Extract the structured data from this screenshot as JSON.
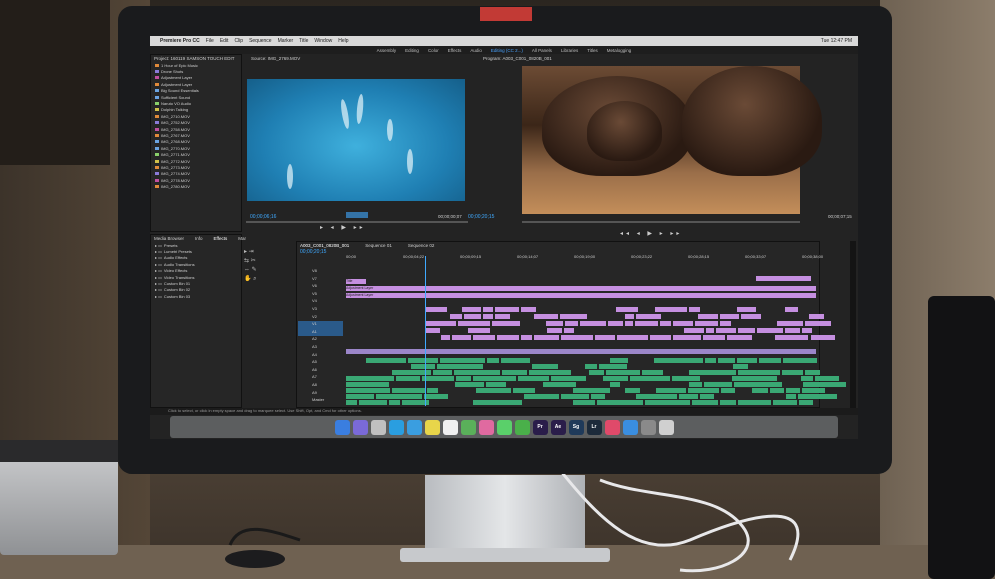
{
  "menubar": {
    "app": "Premiere Pro CC",
    "items": [
      "File",
      "Edit",
      "Clip",
      "Sequence",
      "Marker",
      "Title",
      "Window",
      "Help"
    ],
    "clock": "Tue 12:47 PM"
  },
  "workspaces": [
    "Assembly",
    "Editing",
    "Color",
    "Effects",
    "Audio",
    "Editing (CC 2...)",
    "All Panels",
    "Libraries",
    "Titles",
    "Metalogging"
  ],
  "project_panel": {
    "title": "Project: 160119 SAMSON TOUCH EDIT",
    "items": [
      "1 Hour of Epic Music",
      "Drone Shots",
      "Adjustment Layer",
      "Adjustment Layer",
      "Big Sound Essentials",
      "Sufficient Sound",
      "Naruto VO Audio",
      "Dolphin Talking",
      "IMG_2710.MOV",
      "IMG_2752.MOV",
      "IMG_2758.MOV",
      "IMG_2767.MOV",
      "IMG_2768.MOV",
      "IMG_2770.MOV",
      "IMG_2771.MOV",
      "IMG_2772.MOV",
      "IMG_2773.MOV",
      "IMG_2774.MOV",
      "IMG_2778.MOV",
      "IMG_2780.MOV"
    ]
  },
  "source_monitor": {
    "title": "Source: IMG_2769.MOV",
    "timecode_left": "00;00;06;16",
    "timecode_right": "00;00;00;07"
  },
  "program_monitor": {
    "title": "Program: A003_C001_0820B_001",
    "timecode_left": "00;00;20;15",
    "timecode_right": "00;00;07;15"
  },
  "effects_panel": {
    "tabs": [
      "Media Browser",
      "Info",
      "Effects",
      "Mar"
    ],
    "items": [
      "Presets",
      "Lumetri Presets",
      "Audio Effects",
      "Audio Transitions",
      "Video Effects",
      "Video Transitions",
      "Custom Bin 01",
      "Custom Bin 02",
      "Custom Bin 03"
    ]
  },
  "timeline": {
    "tabs": [
      "A003_C001_0820B_001",
      "Sequence 01",
      "Sequence 02"
    ],
    "timecode": "00;00;20;15",
    "ruler": [
      "00;00",
      "00;00;04;22",
      "00;00;09;15",
      "00;00;14;07",
      "00;00;19;00",
      "00;00;23;22",
      "00;00;28;15",
      "00;00;33;07",
      "00;00;38;00"
    ],
    "clip_labels": [
      "Adjustment Layer",
      "Adjustment Layer",
      "Adjustment Layer",
      "Title"
    ],
    "tracks": [
      "V8",
      "V7",
      "V6",
      "V5",
      "V4",
      "V3",
      "V2",
      "V1",
      "A1",
      "A2",
      "A3",
      "A4",
      "A5",
      "A6",
      "A7",
      "A8",
      "A9",
      "Master"
    ]
  },
  "status": "Click to select, or click in empty space and drag to marquee select. Use Shift, Opt, and Cmd for other options.",
  "dock": [
    "Finder",
    "Siri",
    "Launchpad",
    "Safari",
    "Mail",
    "Notes",
    "Calendar",
    "Maps",
    "Photos",
    "Messages",
    "FaceTime",
    "Pr",
    "Ae",
    "Sg",
    "Lr",
    "iTunes",
    "App Store",
    "Preferences",
    "Trash"
  ],
  "colors": {
    "accent": "#3fa9ff",
    "video_clip": "#c58fe0",
    "audio_clip": "#3aa874",
    "sticker": "#c23a35"
  }
}
